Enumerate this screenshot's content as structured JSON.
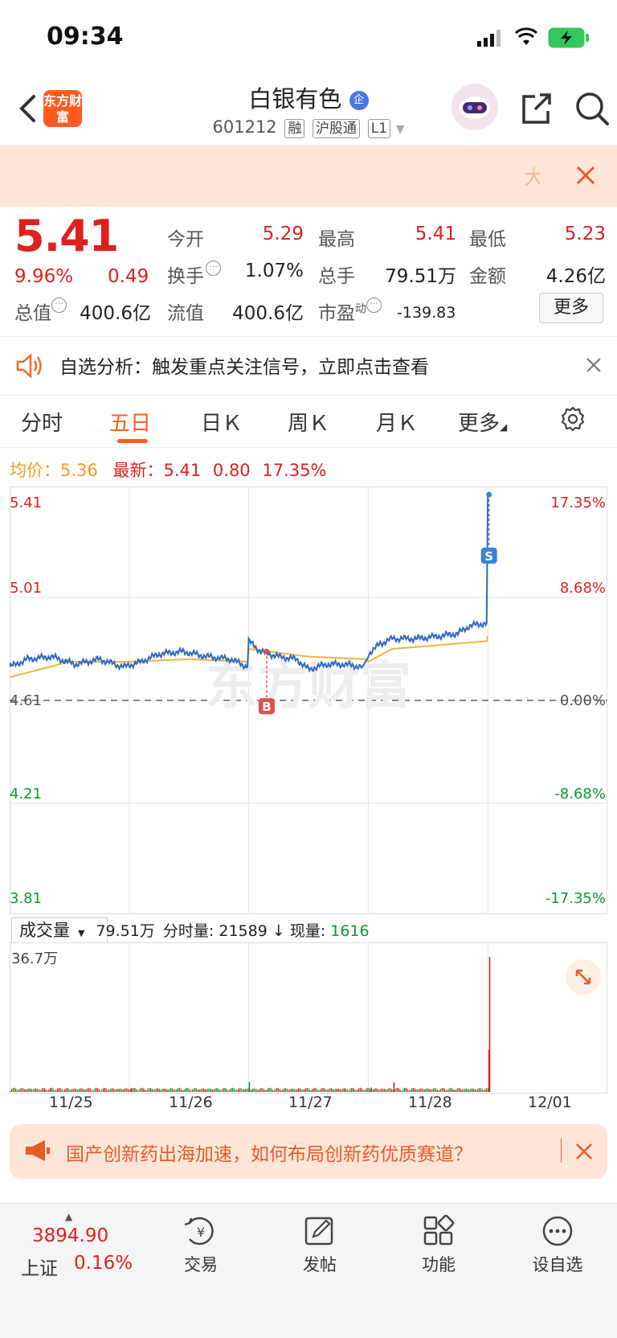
{
  "status_bar": {
    "time": "09:34"
  },
  "header": {
    "logo_text": "东方财富",
    "stock_name": "白银有色",
    "stock_code": "601212",
    "tags": [
      "融",
      "沪股通",
      "L1"
    ]
  },
  "banner": {
    "text": "大"
  },
  "quote": {
    "price": "5.41",
    "change_pct": "9.96%",
    "change": "0.49",
    "rows": [
      [
        {
          "label": "今开",
          "value": "5.29",
          "color": "red"
        },
        {
          "label": "最高",
          "value": "5.41",
          "color": "red"
        },
        {
          "label": "最低",
          "value": "5.23",
          "color": "red"
        }
      ],
      [
        {
          "label": "换手",
          "value": "1.07%",
          "color": "dark"
        },
        {
          "label": "总手",
          "value": "79.51万",
          "color": "dark"
        },
        {
          "label": "金额",
          "value": "4.26亿",
          "color": "dark"
        }
      ]
    ],
    "total_value_label": "总值",
    "total_value": "400.6亿",
    "float_value_label": "流值",
    "float_value": "400.6亿",
    "pe_label": "市盈",
    "pe_sup": "动",
    "pe_value": "-139.83",
    "more_label": "更多"
  },
  "notice": {
    "text": "自选分析：触发重点关注信号，立即点击查看"
  },
  "tabs": [
    {
      "label": "分时",
      "active": false
    },
    {
      "label": "五日",
      "active": true
    },
    {
      "label": "日Ｋ",
      "active": false
    },
    {
      "label": "周Ｋ",
      "active": false
    },
    {
      "label": "月Ｋ",
      "active": false
    },
    {
      "label": "更多",
      "active": false
    }
  ],
  "chart_info": {
    "avg_label": "均价：",
    "avg_value": "5.36",
    "latest_label": "最新：",
    "latest_value": "5.41",
    "latest_change": "0.80",
    "latest_pct": "17.35%"
  },
  "chart_data": {
    "type": "line",
    "title": "",
    "x_dates": [
      "11/25",
      "11/26",
      "11/27",
      "11/28",
      "12/01"
    ],
    "y_left_ticks": [
      "5.41",
      "5.01",
      "4.61",
      "4.21",
      "3.81"
    ],
    "y_right_ticks": [
      "17.35%",
      "8.68%",
      "0.00%",
      "-8.68%",
      "-17.35%"
    ],
    "ylim": [
      3.81,
      5.41
    ],
    "prev_close": 4.61,
    "grid": true,
    "series": [],
    "price_points": [
      [
        0.0,
        4.74
      ],
      [
        0.15,
        4.77
      ],
      [
        0.35,
        4.78
      ],
      [
        0.55,
        4.75
      ],
      [
        0.75,
        4.77
      ],
      [
        0.95,
        4.74
      ],
      [
        1.1,
        4.76
      ],
      [
        1.25,
        4.79
      ],
      [
        1.45,
        4.8
      ],
      [
        1.65,
        4.78
      ],
      [
        1.85,
        4.77
      ],
      [
        1.99,
        4.74
      ],
      [
        2.0,
        4.84
      ],
      [
        2.1,
        4.8
      ],
      [
        2.25,
        4.78
      ],
      [
        2.4,
        4.77
      ],
      [
        2.5,
        4.73
      ],
      [
        2.65,
        4.75
      ],
      [
        2.8,
        4.75
      ],
      [
        2.95,
        4.74
      ],
      [
        3.0,
        4.79
      ],
      [
        3.1,
        4.83
      ],
      [
        3.2,
        4.85
      ],
      [
        3.4,
        4.85
      ],
      [
        3.6,
        4.86
      ],
      [
        3.75,
        4.87
      ],
      [
        3.85,
        4.9
      ],
      [
        3.99,
        4.91
      ],
      [
        4.0,
        5.39
      ],
      [
        4.01,
        5.4
      ]
    ],
    "avg_points": [
      [
        0.0,
        4.7
      ],
      [
        0.5,
        4.76
      ],
      [
        1.0,
        4.76
      ],
      [
        1.5,
        4.77
      ],
      [
        1.99,
        4.76
      ],
      [
        2.0,
        4.81
      ],
      [
        2.5,
        4.78
      ],
      [
        2.99,
        4.77
      ],
      [
        3.0,
        4.76
      ],
      [
        3.2,
        4.81
      ],
      [
        3.99,
        4.84
      ],
      [
        4.0,
        4.86
      ]
    ],
    "markers": [
      {
        "label": "B",
        "day": 2.15,
        "price": 4.8,
        "color": "#e05050"
      },
      {
        "label": "S",
        "day": 4.01,
        "price": 5.41,
        "color": "#3a82d8"
      }
    ]
  },
  "volume": {
    "selector": "成交量",
    "total": "79.51万",
    "fs_label": "分时量:",
    "fs_value": "21589",
    "cur_label": "现量:",
    "cur_value": "1616",
    "max_label": "36.7万",
    "max_value": 367000,
    "spikes": [
      {
        "day": 2.0,
        "v": 27000
      },
      {
        "day": 3.21,
        "v": 26000
      },
      {
        "day": 3.02,
        "v": 12000
      },
      {
        "day": 1.01,
        "v": 10000
      },
      {
        "day": 4.01,
        "v": 367000
      },
      {
        "day": 4.005,
        "v": 115000
      }
    ]
  },
  "promo": {
    "text": "国产创新药出海加速，如何布局创新药优质赛道？"
  },
  "bottom_nav": {
    "index_value": "3894.90",
    "index_name": "上证",
    "index_change": "0.16%",
    "items": [
      "交易",
      "发帖",
      "功能",
      "设自选"
    ]
  },
  "watermark": "东方财富"
}
